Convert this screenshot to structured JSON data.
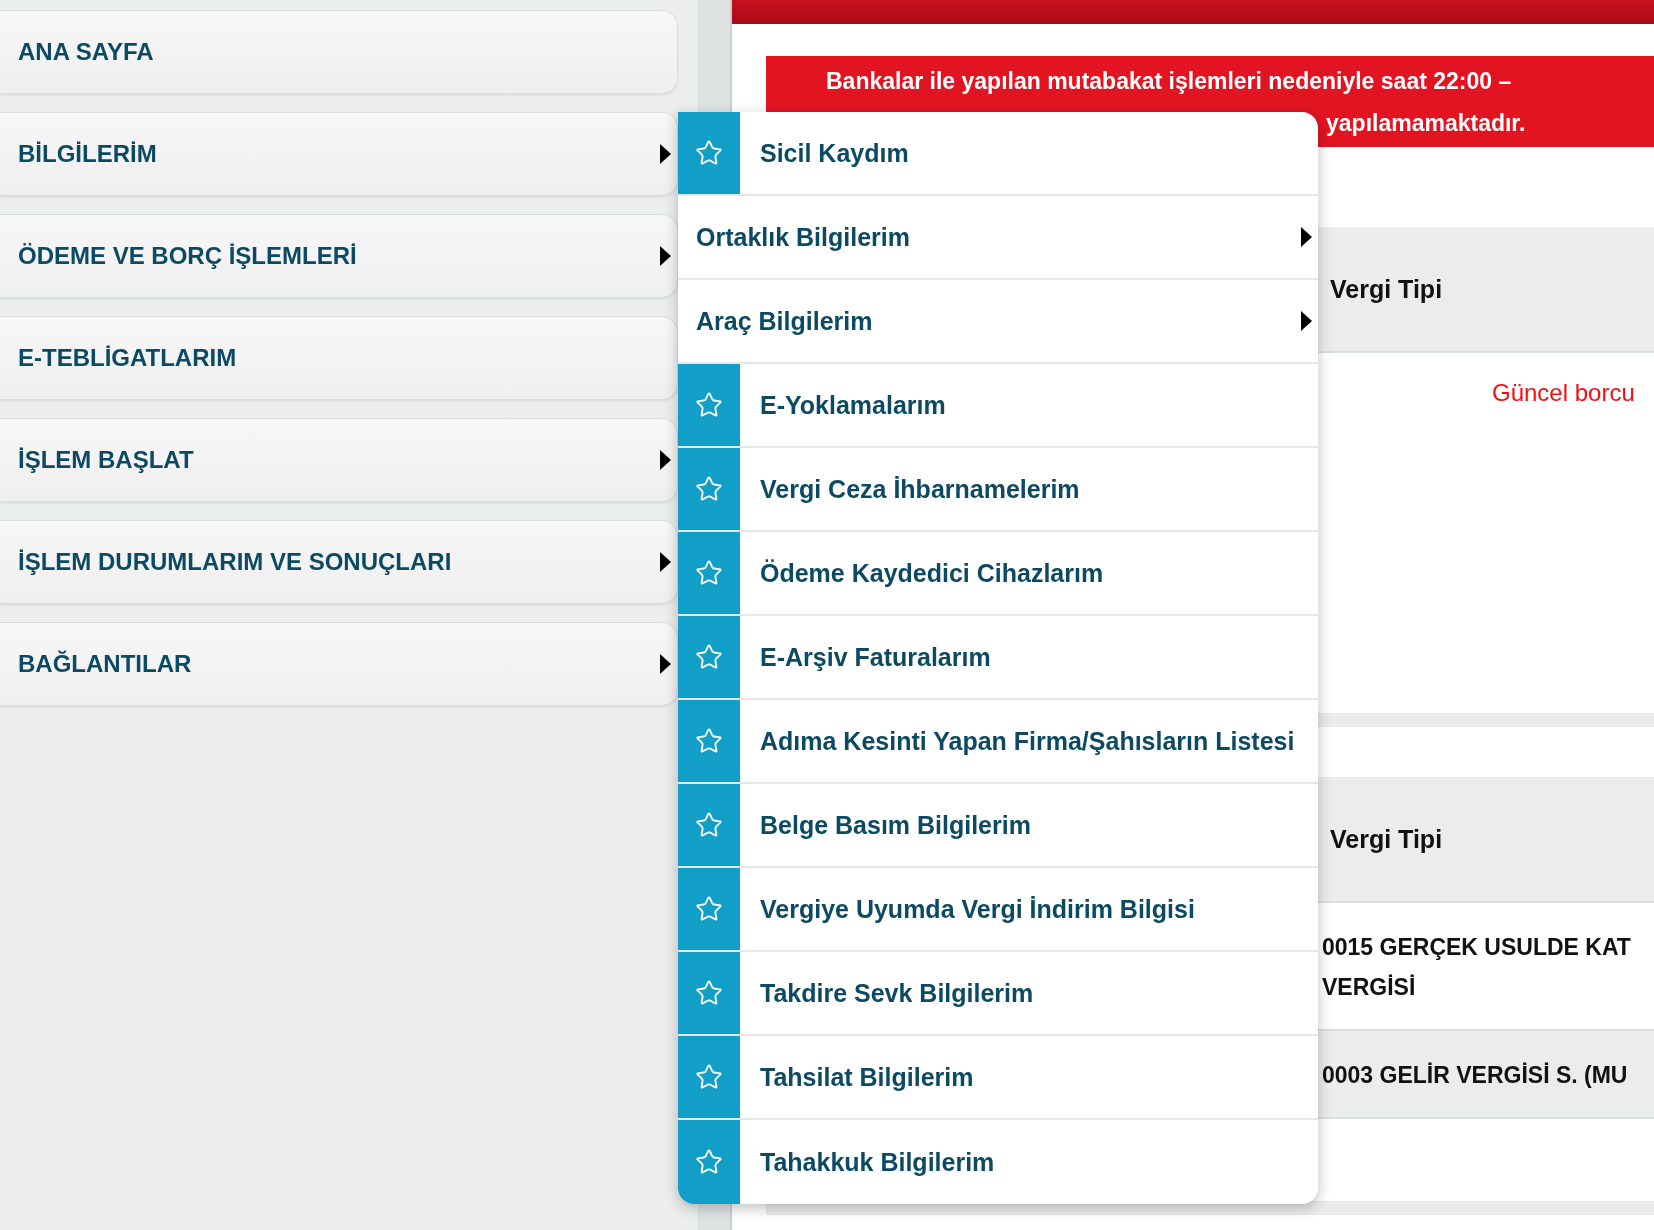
{
  "sidebar": {
    "items": [
      {
        "label": "ANA SAYFA",
        "kind": "link"
      },
      {
        "label": "BİLGİLERİM",
        "kind": "submenu"
      },
      {
        "label": "ÖDEME VE BORÇ İŞLEMLERİ",
        "kind": "submenu"
      },
      {
        "label": "E-TEBLİGATLARIM",
        "kind": "link"
      },
      {
        "label": "İŞLEM BAŞLAT",
        "kind": "submenu"
      },
      {
        "label": "İŞLEM DURUMLARIM VE SONUÇLARI",
        "kind": "submenu"
      },
      {
        "label": "BAĞLANTILAR",
        "kind": "submenu"
      }
    ]
  },
  "submenu": {
    "items": [
      {
        "label": "Sicil Kaydım",
        "kind": "favorite"
      },
      {
        "label": "Ortaklık Bilgilerim",
        "kind": "submenu"
      },
      {
        "label": "Araç Bilgilerim",
        "kind": "submenu"
      },
      {
        "label": "E-Yoklamalarım",
        "kind": "favorite"
      },
      {
        "label": "Vergi Ceza İhbarnamelerim",
        "kind": "favorite"
      },
      {
        "label": "Ödeme Kaydedici Cihazlarım",
        "kind": "favorite"
      },
      {
        "label": "E-Arşiv Faturalarım",
        "kind": "favorite"
      },
      {
        "label": "Adıma Kesinti Yapan Firma/Şahısların Listesi",
        "kind": "favorite"
      },
      {
        "label": "Belge Basım Bilgilerim",
        "kind": "favorite"
      },
      {
        "label": "Vergiye Uyumda Vergi İndirim Bilgisi",
        "kind": "favorite"
      },
      {
        "label": "Takdire Sevk Bilgilerim",
        "kind": "favorite"
      },
      {
        "label": "Tahsilat Bilgilerim",
        "kind": "favorite"
      },
      {
        "label": "Tahakkuk Bilgilerim",
        "kind": "favorite"
      }
    ]
  },
  "notice": {
    "lines": [
      "Bankalar ile yapılan mutabakat işlemleri nedeniyle saat 22:00 –",
      "yapılamamaktadır."
    ]
  },
  "table_1": {
    "header": "Vergi Tipi",
    "message": "Güncel borcu"
  },
  "table_2": {
    "header": "Vergi Tipi",
    "rows": [
      {
        "lines": [
          "0015 GERÇEK USULDE KAT",
          "VERGİSİ"
        ]
      },
      {
        "lines": [
          "0003 GELİR VERGİSİ S. (MU"
        ]
      }
    ]
  }
}
